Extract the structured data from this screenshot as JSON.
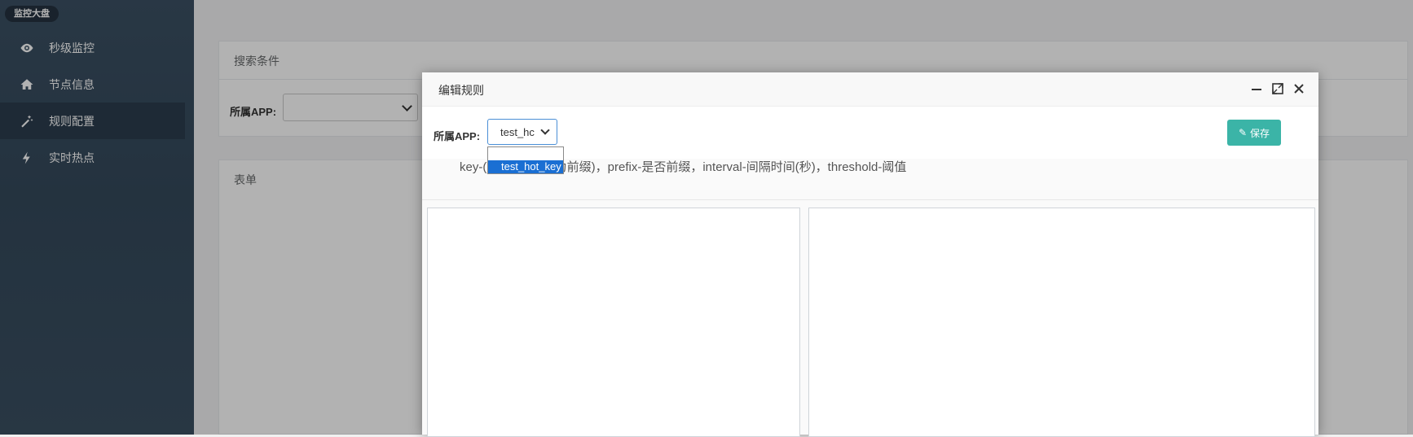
{
  "sidebar": {
    "brand": "监控大盘",
    "items": [
      {
        "label": "秒级监控",
        "icon": "eye-icon",
        "active": false
      },
      {
        "label": "节点信息",
        "icon": "home-icon",
        "active": false
      },
      {
        "label": "规则配置",
        "icon": "magic-wand-icon",
        "active": true
      },
      {
        "label": "实时热点",
        "icon": "bolt-icon",
        "active": false
      }
    ]
  },
  "search_panel": {
    "title": "搜索条件",
    "app_label": "所属APP:",
    "app_value": ""
  },
  "form_panel": {
    "title": "表单"
  },
  "modal": {
    "title": "编辑规则",
    "app_label": "所属APP:",
    "app_selected": "test_hc",
    "dropdown_options": [
      "",
      "test_hot_key"
    ],
    "save_label": "保存",
    "hint": "key-(为空表示key为前缀)，prefix-是否前缀，interval-间隔时间(秒)，threshold-阈值"
  },
  "colors": {
    "sidebar_bg": "#36495a",
    "active_item": "#2c3d4e",
    "save_button": "#3bb4a7",
    "dropdown_highlight": "#1a6fd3"
  }
}
